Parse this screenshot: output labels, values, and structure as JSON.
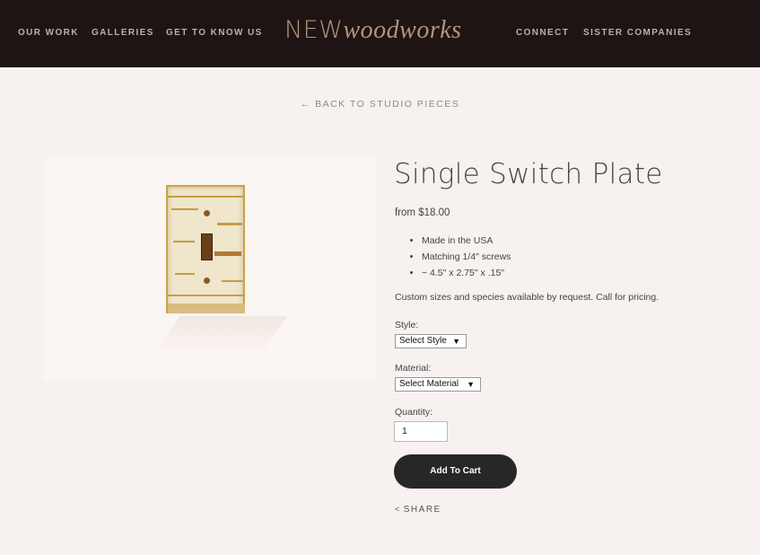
{
  "nav": {
    "left": [
      "OUR WORK",
      "GALLERIES",
      "GET TO KNOW US"
    ],
    "right": [
      "CONNECT",
      "SISTER COMPANIES"
    ],
    "logo_caps": "NEW",
    "logo_italic": "woodworks"
  },
  "back_link": "← BACK TO STUDIO PIECES",
  "product": {
    "title": "Single Switch Plate",
    "price": "from $18.00",
    "features": [
      "Made in the USA",
      "Matching 1/4\" screws",
      "~ 4.5\" x 2.75\" x .15\""
    ],
    "note": "Custom sizes and species available by request. Call for pricing.",
    "style_label": "Style:",
    "style_value": "Select Style",
    "material_label": "Material:",
    "material_value": "Select Material",
    "quantity_label": "Quantity:",
    "quantity_value": "1",
    "add_to_cart": "Add To Cart",
    "share": "SHARE"
  },
  "colors": {
    "topbar": "#1d1413",
    "background": "#f7f1f0",
    "logo": "#b39580",
    "button": "#272727"
  }
}
